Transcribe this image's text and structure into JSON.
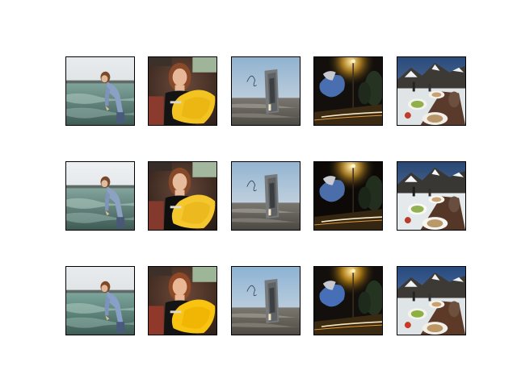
{
  "figure": {
    "rows": [
      {
        "row_index": 0,
        "tiles": [
          {
            "subject": "woman-bending-over-water"
          },
          {
            "subject": "woman-with-yellow-pillow"
          },
          {
            "subject": "tall-object-on-beach"
          },
          {
            "subject": "night-street-scene"
          },
          {
            "subject": "outdoor-dining-table"
          }
        ]
      },
      {
        "row_index": 1,
        "tiles": [
          {
            "subject": "woman-bending-over-water"
          },
          {
            "subject": "woman-with-yellow-pillow"
          },
          {
            "subject": "tall-object-on-beach"
          },
          {
            "subject": "night-street-scene"
          },
          {
            "subject": "outdoor-dining-table"
          }
        ]
      },
      {
        "row_index": 2,
        "tiles": [
          {
            "subject": "woman-bending-over-water"
          },
          {
            "subject": "woman-with-yellow-pillow"
          },
          {
            "subject": "tall-object-on-beach"
          },
          {
            "subject": "night-street-scene"
          },
          {
            "subject": "outdoor-dining-table"
          }
        ]
      }
    ]
  }
}
